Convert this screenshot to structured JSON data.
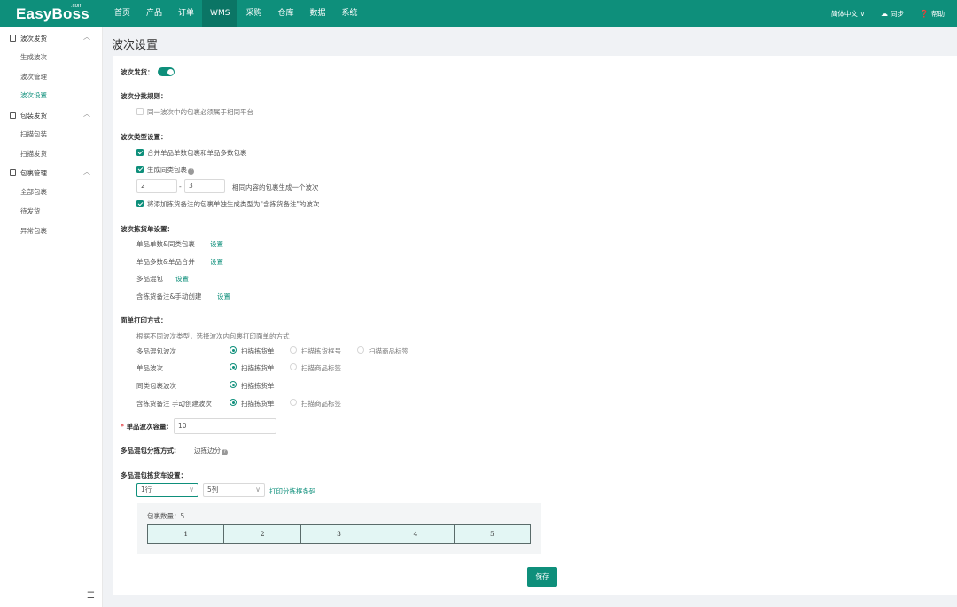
{
  "header": {
    "logo": "EasyBoss",
    "logo_suffix": ".com",
    "nav": [
      "首页",
      "产品",
      "订单",
      "WMS",
      "采购",
      "仓库",
      "数据",
      "系统"
    ],
    "active_nav": "WMS",
    "language": "简体中文",
    "sync": "同步",
    "help": "帮助"
  },
  "sidebar": {
    "groups": [
      {
        "label": "波次发货",
        "items": [
          "生成波次",
          "波次管理",
          "波次设置"
        ]
      },
      {
        "label": "包装发货",
        "items": [
          "扫描包装",
          "扫描发货"
        ]
      },
      {
        "label": "包裹管理",
        "items": [
          "全部包裹",
          "待发货",
          "异常包裹"
        ]
      }
    ],
    "active_item": "波次设置"
  },
  "page": {
    "title": "波次设置"
  },
  "settings": {
    "wave_shipping_label": "波次发货：",
    "wave_shipping_on": true,
    "split_rule_title": "波次分批规则：",
    "split_rule_option": "同一波次中的包裹必须属于相同平台",
    "split_rule_checked": false,
    "type_title": "波次类型设置：",
    "type_opt1": "合并单品单数包裹和单品多数包裹",
    "type_opt1_checked": true,
    "type_opt2": "生成同类包裹",
    "type_opt2_checked": true,
    "range_from": "2",
    "range_sep": "-",
    "range_to": "3",
    "range_hint": "相同内容的包裹生成一个波次",
    "type_opt3": "将添加拣货备注的包裹单独生成类型为\"含拣货备注\"的波次",
    "type_opt3_checked": true,
    "pick_title": "波次拣货单设置：",
    "pick_rows": [
      {
        "label": "单品单数&同类包裹",
        "link": "设置"
      },
      {
        "label": "单品多数&单品合并",
        "link": "设置"
      },
      {
        "label": "多品混包",
        "link": "设置"
      },
      {
        "label": "含拣货备注&手动创建",
        "link": "设置"
      }
    ],
    "print_title": "面单打印方式：",
    "print_hint": "根据不同波次类型，选择波次内包裹打印面单的方式",
    "print_rows": [
      {
        "label": "多品混包波次",
        "options": [
          "扫描拣货单",
          "扫描拣货框号",
          "扫描商品标签"
        ],
        "selected": 0
      },
      {
        "label": "单品波次",
        "options": [
          "扫描拣货单",
          "扫描商品标签"
        ],
        "selected": 0
      },
      {
        "label": "同类包裹波次",
        "options": [
          "扫描拣货单"
        ],
        "selected": 0
      },
      {
        "label": "含拣货备注 手动创建波次",
        "options": [
          "扫描拣货单",
          "扫描商品标签"
        ],
        "selected": 0
      }
    ],
    "capacity_label": "单品波次容量:",
    "capacity_required": "*",
    "capacity_value": "10",
    "multi_sort_label": "多品混包分拣方式:",
    "multi_sort_value": "边拣边分",
    "cart_title": "多品混包拣货车设置：",
    "rows_select": "1行",
    "cols_select": "5列",
    "print_barcode_link": "打印分拣框条码",
    "package_count_label": "包裹数量：",
    "package_count": "5",
    "cells": [
      "1",
      "2",
      "3",
      "4",
      "5"
    ],
    "save_button": "保存"
  },
  "colors": {
    "brand": "#0e8f7b",
    "nav_active": "#0b7565"
  }
}
